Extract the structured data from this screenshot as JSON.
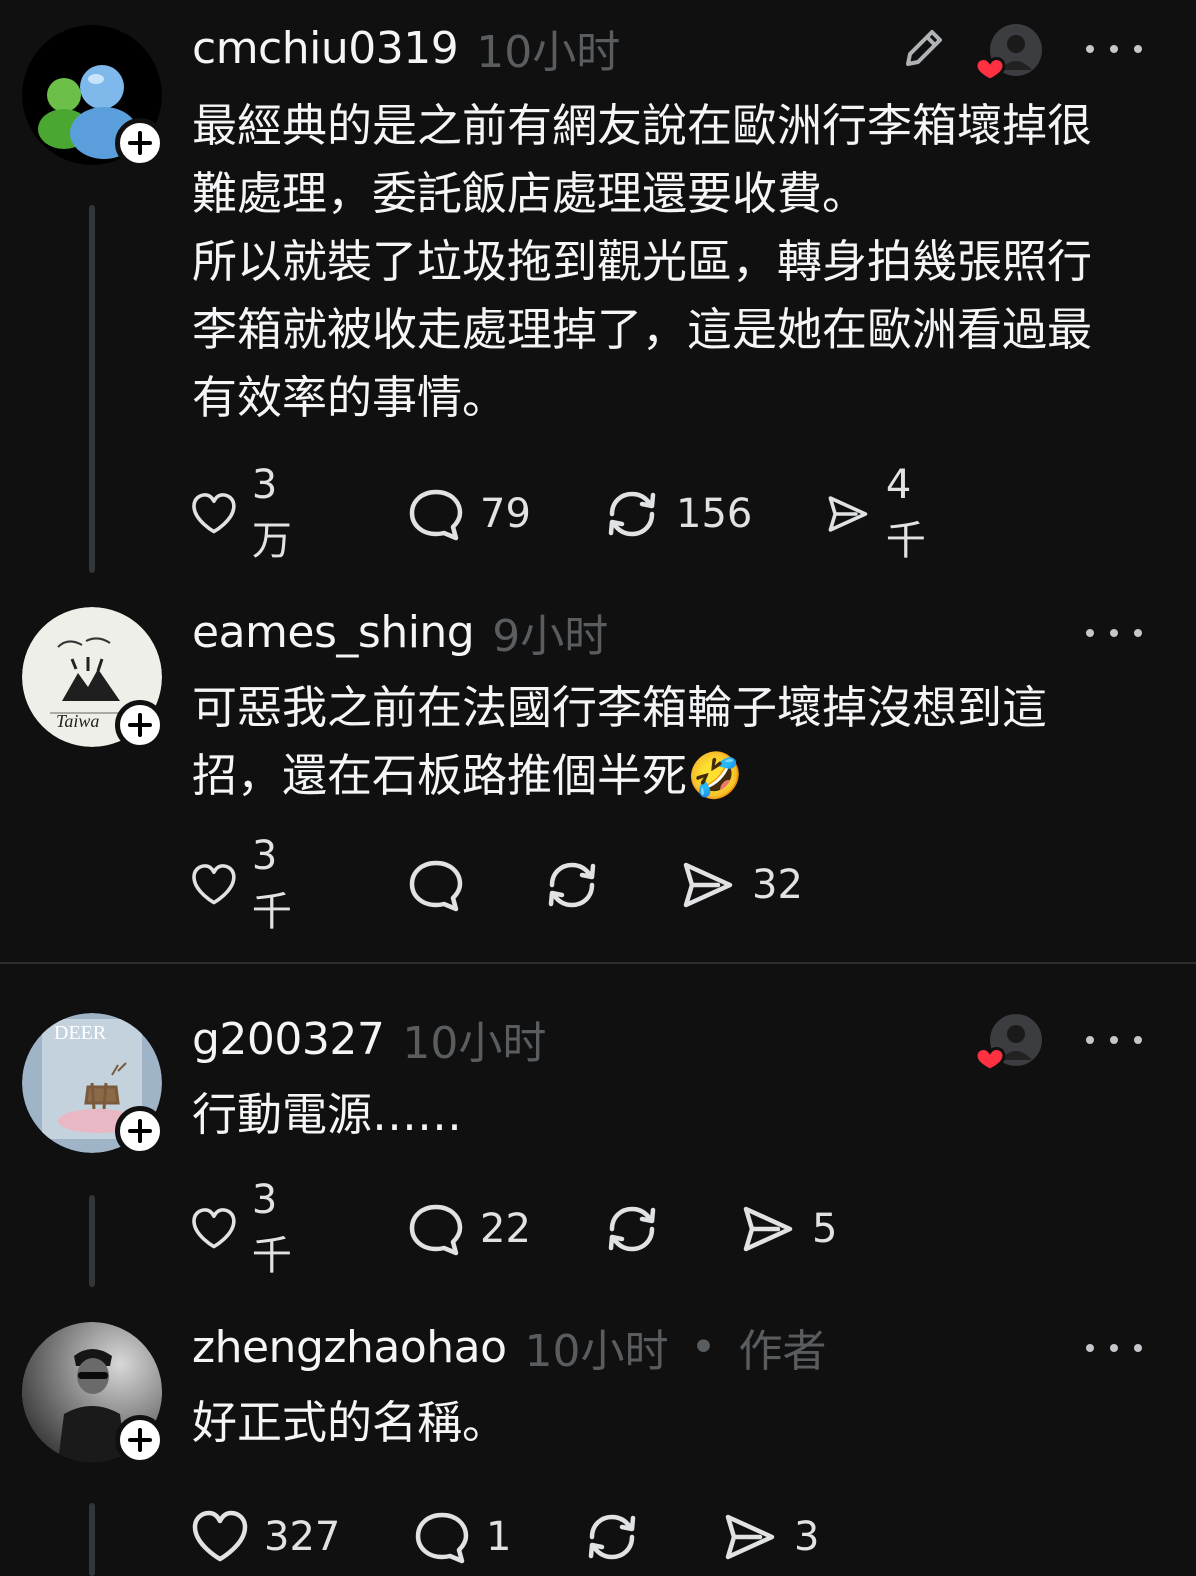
{
  "posts": [
    {
      "username": "cmchiu0319",
      "time": "10小时",
      "content_lines": [
        "最經典的是之前有網友說在歐洲行李箱壞掉很",
        "難處理，委託飯店處理還要收費。",
        "所以就裝了垃圾拖到觀光區，轉身拍幾張照行",
        "李箱就被收走處理掉了，這是她在歐洲看過最",
        "有效率的事情。"
      ],
      "likes": "3万",
      "comments": "79",
      "reposts": "156",
      "shares": "4千"
    },
    {
      "username": "eames_shing",
      "time": "9小时",
      "avatar_text": "Taiwa",
      "content_lines": [
        "可惡我之前在法國行李箱輪子壞掉沒想到這",
        "招，還在石板路推個半死🤣"
      ],
      "likes": "3千",
      "comments": "",
      "reposts": "",
      "shares": "32"
    },
    {
      "username": "g200327",
      "time": "10小时",
      "avatar_text": "DEER",
      "content_lines": [
        "行動電源……"
      ],
      "likes": "3千",
      "comments": "22",
      "reposts": "",
      "shares": "5"
    },
    {
      "username": "zhengzhaohao",
      "time": "10小时",
      "separator": "•",
      "author_label": "作者",
      "content_lines": [
        "好正式的名稱。"
      ],
      "likes": "327",
      "comments": "1",
      "reposts": "",
      "shares": "3"
    }
  ],
  "colors": {
    "background": "#101010",
    "text": "#f3f5f7",
    "muted": "#5a5d60",
    "heart": "#ff3040"
  },
  "icons": [
    "heart-icon",
    "comment-icon",
    "repost-icon",
    "share-icon",
    "more-icon",
    "edit-icon",
    "follow-plus-icon"
  ]
}
